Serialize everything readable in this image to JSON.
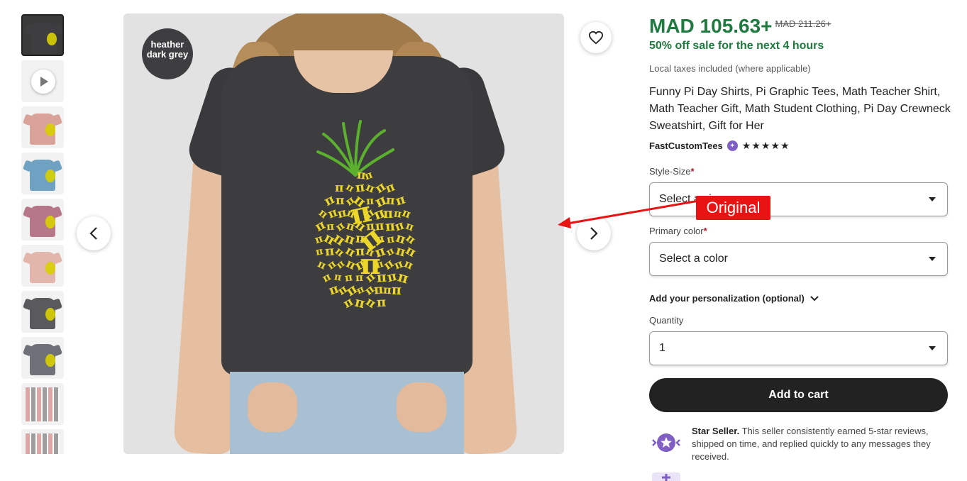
{
  "gallery": {
    "badge": "heather dark grey",
    "thumbnails": [
      {
        "kind": "image",
        "color": "#3e3e40"
      },
      {
        "kind": "video",
        "color": "#f3f3f3"
      },
      {
        "kind": "image",
        "color": "#d9a39a"
      },
      {
        "kind": "image",
        "color": "#6fa2c2"
      },
      {
        "kind": "image",
        "color": "#b67888"
      },
      {
        "kind": "image",
        "color": "#e2b6aa"
      },
      {
        "kind": "image",
        "color": "#5a5a5c"
      },
      {
        "kind": "image",
        "color": "#6e7177"
      },
      {
        "kind": "sheet",
        "color": "#f5f5f5"
      },
      {
        "kind": "sheet",
        "color": "#f5f5f5"
      }
    ]
  },
  "product": {
    "price": "MAD 105.63+",
    "original_price": "MAD 211.26+",
    "sale_text": "50% off sale for the next 4 hours",
    "taxes": "Local taxes included (where applicable)",
    "title": "Funny Pi Day Shirts, Pi Graphic Tees, Math Teacher Shirt, Math Teacher Gift, Math Student Clothing, Pi Day Crewneck Sweatshirt, Gift for Her",
    "shop_name": "FastCustomTees",
    "rating": "★★★★★"
  },
  "options": {
    "style_size_label": "Style-Size",
    "style_size_value": "Select a size",
    "primary_color_label": "Primary color",
    "primary_color_value": "Select a color",
    "personalization_label": "Add your personalization (optional)",
    "quantity_label": "Quantity",
    "quantity_value": "1"
  },
  "actions": {
    "add_to_cart": "Add to cart"
  },
  "seller": {
    "title": "Star Seller.",
    "text": "This seller consistently earned 5-star reviews, shipped on time, and replied quickly to any messages they received."
  },
  "annotation": {
    "label": "Original",
    "color": "#e81414"
  },
  "colors": {
    "price_green": "#1f7a3f",
    "button_dark": "#222222",
    "required_red": "#a61a2e"
  }
}
